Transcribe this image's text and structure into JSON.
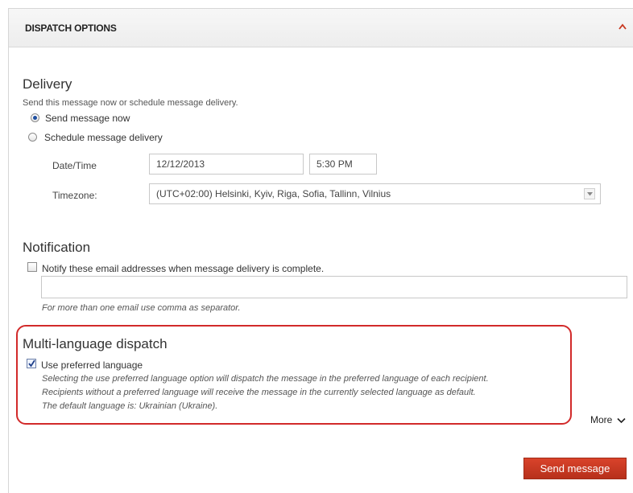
{
  "panel": {
    "title": "DISPATCH OPTIONS"
  },
  "delivery": {
    "heading": "Delivery",
    "description": "Send this message now or schedule message delivery.",
    "option_now": "Send message now",
    "option_schedule": "Schedule message delivery",
    "datetime_label": "Date/Time",
    "date_value": "12/12/2013",
    "time_value": "5:30 PM",
    "timezone_label": "Timezone:",
    "timezone_value": "(UTC+02:00) Helsinki, Kyiv, Riga, Sofia, Tallinn, Vilnius",
    "selected": "now"
  },
  "notification": {
    "heading": "Notification",
    "checkbox_label": "Notify these email addresses when message delivery is complete.",
    "email_value": "",
    "hint": "For more than one email use comma as separator.",
    "checked": false
  },
  "multilanguage": {
    "heading": "Multi-language dispatch",
    "checkbox_label": "Use preferred language",
    "checked": true,
    "desc_line1": "Selecting the use preferred language option will dispatch the message in the preferred language of each recipient.",
    "desc_line2": "Recipients without a preferred language will receive the message in the currently selected language as default.",
    "desc_line3": "The default language is: Ukrainian (Ukraine)."
  },
  "footer": {
    "more_label": "More",
    "send_label": "Send message"
  },
  "colors": {
    "accent": "#c8371f",
    "highlight_border": "#d22a2a",
    "radio_dot": "#1e4fa0"
  }
}
